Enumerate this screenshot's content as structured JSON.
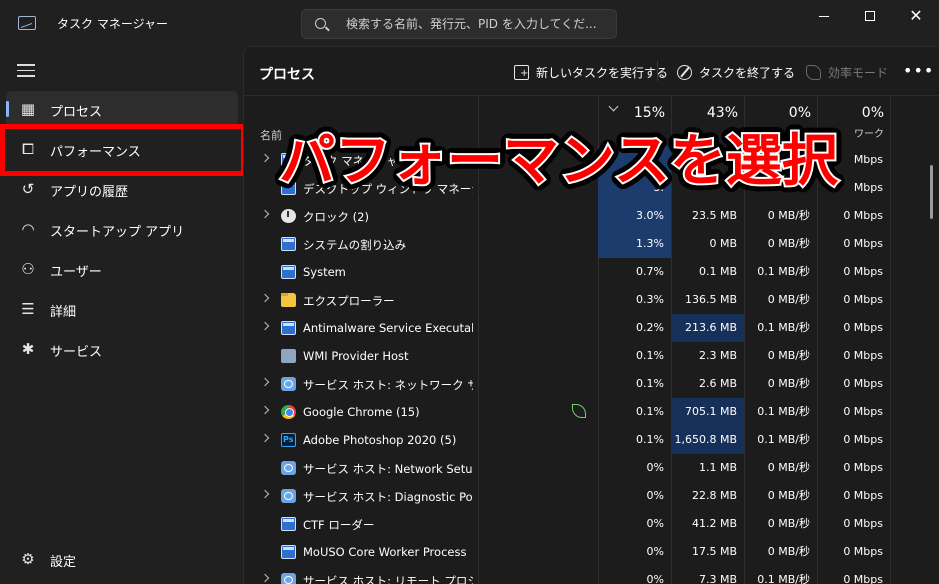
{
  "app": {
    "title": "タスク マネージャー"
  },
  "search": {
    "placeholder": "検索する名前、発行元、PID を入力してくだ..."
  },
  "window_controls": {
    "minimize": "minimize",
    "maximize": "maximize",
    "close": "✕"
  },
  "sidebar": {
    "items": [
      {
        "label": "プロセス",
        "icon": "processes-icon",
        "active": true
      },
      {
        "label": "パフォーマンス",
        "icon": "performance-icon",
        "active": false
      },
      {
        "label": "アプリの履歴",
        "icon": "history-icon",
        "active": false
      },
      {
        "label": "スタートアップ アプリ",
        "icon": "startup-icon",
        "active": false
      },
      {
        "label": "ユーザー",
        "icon": "users-icon",
        "active": false
      },
      {
        "label": "詳細",
        "icon": "details-icon",
        "active": false
      },
      {
        "label": "サービス",
        "icon": "services-icon",
        "active": false
      }
    ],
    "settings_label": "設定"
  },
  "main": {
    "title": "プロセス",
    "toolbar": {
      "new_task": "新しいタスクを実行する",
      "end_task": "タスクを終了する",
      "efficiency": "効率モード",
      "more": "•••"
    },
    "columns": {
      "name": "名前",
      "cpu_pct": "15%",
      "mem_pct": "43%",
      "disk_pct": "0%",
      "net_pct": "0%",
      "net_label": "ワーク"
    },
    "rows": [
      {
        "name": "タスク マネージャー",
        "icon": "window",
        "expand": true,
        "cpu": "",
        "mem": "",
        "disk": "",
        "net": "Mbps"
      },
      {
        "name": "デスクトップ ウィンドウ マネージャー",
        "icon": "window",
        "expand": false,
        "cpu": "3.",
        "mem": "",
        "disk": "",
        "net": "Mbps"
      },
      {
        "name": "クロック (2)",
        "icon": "clock",
        "expand": true,
        "cpu": "3.0%",
        "mem": "23.5 MB",
        "disk": "0 MB/秒",
        "net": "0 Mbps"
      },
      {
        "name": "システムの割り込み",
        "icon": "window",
        "expand": false,
        "cpu": "1.3%",
        "mem": "0 MB",
        "disk": "0 MB/秒",
        "net": "0 Mbps"
      },
      {
        "name": "System",
        "icon": "window",
        "expand": false,
        "cpu": "0.7%",
        "mem": "0.1 MB",
        "disk": "0.1 MB/秒",
        "net": "0 Mbps"
      },
      {
        "name": "エクスプローラー",
        "icon": "folder",
        "expand": true,
        "cpu": "0.3%",
        "mem": "136.5 MB",
        "disk": "0 MB/秒",
        "net": "0 Mbps"
      },
      {
        "name": "Antimalware Service Executable",
        "icon": "window",
        "expand": true,
        "cpu": "0.2%",
        "mem": "213.6 MB",
        "disk": "0.1 MB/秒",
        "net": "0 Mbps"
      },
      {
        "name": "WMI Provider Host",
        "icon": "wmi",
        "expand": false,
        "cpu": "0.1%",
        "mem": "2.3 MB",
        "disk": "0 MB/秒",
        "net": "0 Mbps"
      },
      {
        "name": "サービス ホスト: ネットワーク サービス",
        "icon": "gear",
        "expand": true,
        "cpu": "0.1%",
        "mem": "2.6 MB",
        "disk": "0 MB/秒",
        "net": "0 Mbps"
      },
      {
        "name": "Google Chrome (15)",
        "icon": "chrome",
        "expand": true,
        "cpu": "0.1%",
        "mem": "705.1 MB",
        "disk": "0.1 MB/秒",
        "net": "0 Mbps",
        "efficiency": true
      },
      {
        "name": "Adobe Photoshop 2020 (5)",
        "icon": "ps",
        "expand": true,
        "cpu": "0.1%",
        "mem": "1,650.8 MB",
        "disk": "0.1 MB/秒",
        "net": "0 Mbps"
      },
      {
        "name": "サービス ホスト: Network Setup S...",
        "icon": "gear",
        "expand": false,
        "cpu": "0%",
        "mem": "1.1 MB",
        "disk": "0 MB/秒",
        "net": "0 Mbps"
      },
      {
        "name": "サービス ホスト: Diagnostic Polic...",
        "icon": "gear",
        "expand": true,
        "cpu": "0%",
        "mem": "22.8 MB",
        "disk": "0 MB/秒",
        "net": "0 Mbps"
      },
      {
        "name": "CTF ローダー",
        "icon": "window",
        "expand": false,
        "cpu": "0%",
        "mem": "41.2 MB",
        "disk": "0 MB/秒",
        "net": "0 Mbps"
      },
      {
        "name": "MoUSO Core Worker Process",
        "icon": "window",
        "expand": false,
        "cpu": "0%",
        "mem": "17.5 MB",
        "disk": "0 MB/秒",
        "net": "0 Mbps"
      },
      {
        "name": "サービス ホスト: リモート プロシージ...",
        "icon": "gear",
        "expand": true,
        "cpu": "0%",
        "mem": "7.3 MB",
        "disk": "0.1 MB/秒",
        "net": "0 Mbps"
      }
    ]
  },
  "overlay": {
    "caption": "パフォーマンスを選択"
  },
  "colors": {
    "accent": "#8ab4f8",
    "highlight": "#ff0000",
    "cpu_heat_strong": "#1c3c6e",
    "cpu_heat_light": "#16305a",
    "caption_fill": "#ff0000",
    "caption_stroke": "#000000"
  }
}
